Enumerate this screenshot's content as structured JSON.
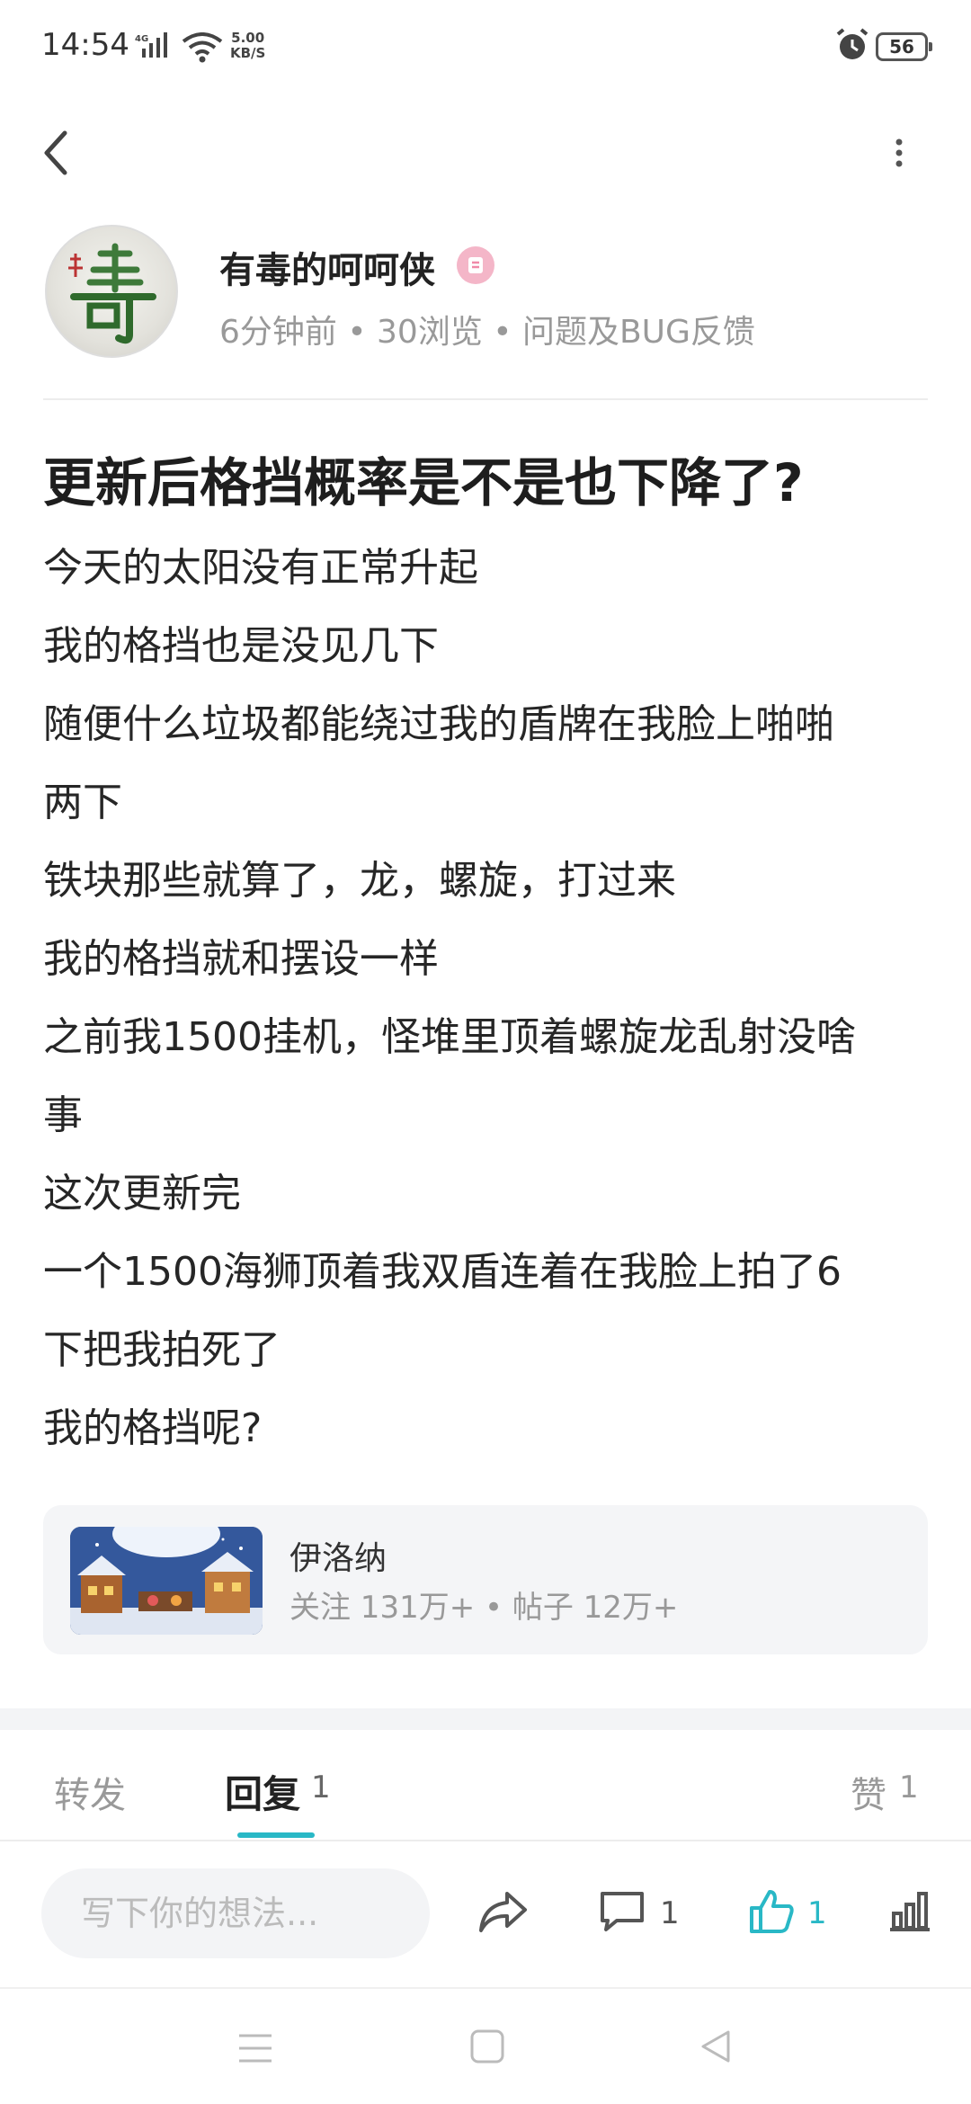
{
  "status_bar": {
    "time": "14:54",
    "network": "4G",
    "speed_value": "5.00",
    "speed_unit": "KB/S",
    "battery": "56"
  },
  "author": {
    "name": "有毒的呵呵侠",
    "meta": "6分钟前 • 30浏览 • 问题及BUG反馈"
  },
  "post": {
    "title": "更新后格挡概率是不是也下降了?",
    "lines": [
      "今天的太阳没有正常升起",
      "我的格挡也是没见几下",
      "随便什么垃圾都能绕过我的盾牌在我脸上啪啪",
      "两下",
      "铁块那些就算了，龙，螺旋，打过来",
      "我的格挡就和摆设一样",
      "之前我1500挂机，怪堆里顶着螺旋龙乱射没啥",
      "事",
      "这次更新完",
      "一个1500海狮顶着我双盾连着在我脸上拍了6",
      "下把我拍死了",
      "我的格挡呢?"
    ]
  },
  "forum": {
    "name": "伊洛纳",
    "stats": "关注 131万+ • 帖子 12万+"
  },
  "tabs": {
    "forward": "转发",
    "reply": "回复",
    "reply_count": "1",
    "like": "赞",
    "like_count": "1"
  },
  "action_bar": {
    "input_placeholder": "写下你的想法...",
    "comment_count": "1",
    "like_count": "1"
  },
  "colors": {
    "accent": "#29b8c6",
    "muted_text": "#999999",
    "card_bg": "#f4f5f7"
  }
}
